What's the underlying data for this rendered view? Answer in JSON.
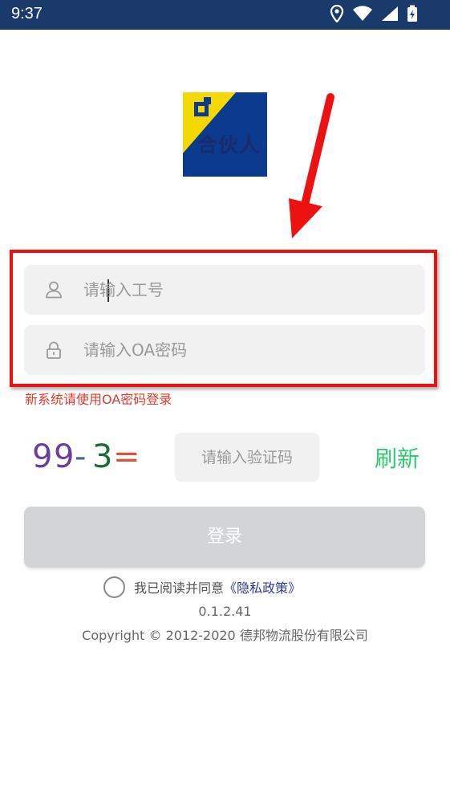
{
  "status_bar": {
    "time": "9:37",
    "icons": [
      "location-icon",
      "wifi-icon",
      "signal-icon",
      "battery-charging-icon"
    ]
  },
  "logo": {
    "text": "合伙人",
    "colors": {
      "blue": "#0b3a8f",
      "yellow": "#f5d800"
    }
  },
  "login_form": {
    "username": {
      "placeholder": "请输入工号",
      "value": "",
      "icon": "user-icon"
    },
    "password": {
      "placeholder": "请输入OA密码",
      "value": "",
      "icon": "lock-icon"
    },
    "notice": "新系统请使用OA密码登录",
    "captcha": {
      "image_text": "99-3=",
      "placeholder": "请输入验证码",
      "refresh_label": "刷新"
    },
    "login_label": "登录",
    "agreement": {
      "text": "我已阅读并同意",
      "policy_link": "《隐私政策》",
      "checked": false
    }
  },
  "footer": {
    "version": "0.1.2.41",
    "copyright": "Copyright © 2012-2020 德邦物流股份有限公司"
  },
  "colors": {
    "status_bar": "#1a3a6b",
    "highlight": "#ee1111",
    "notice": "#e03a2a",
    "refresh": "#2ecc71",
    "login_button": "#d2d4d5",
    "policy_link": "#2b3a8f"
  }
}
